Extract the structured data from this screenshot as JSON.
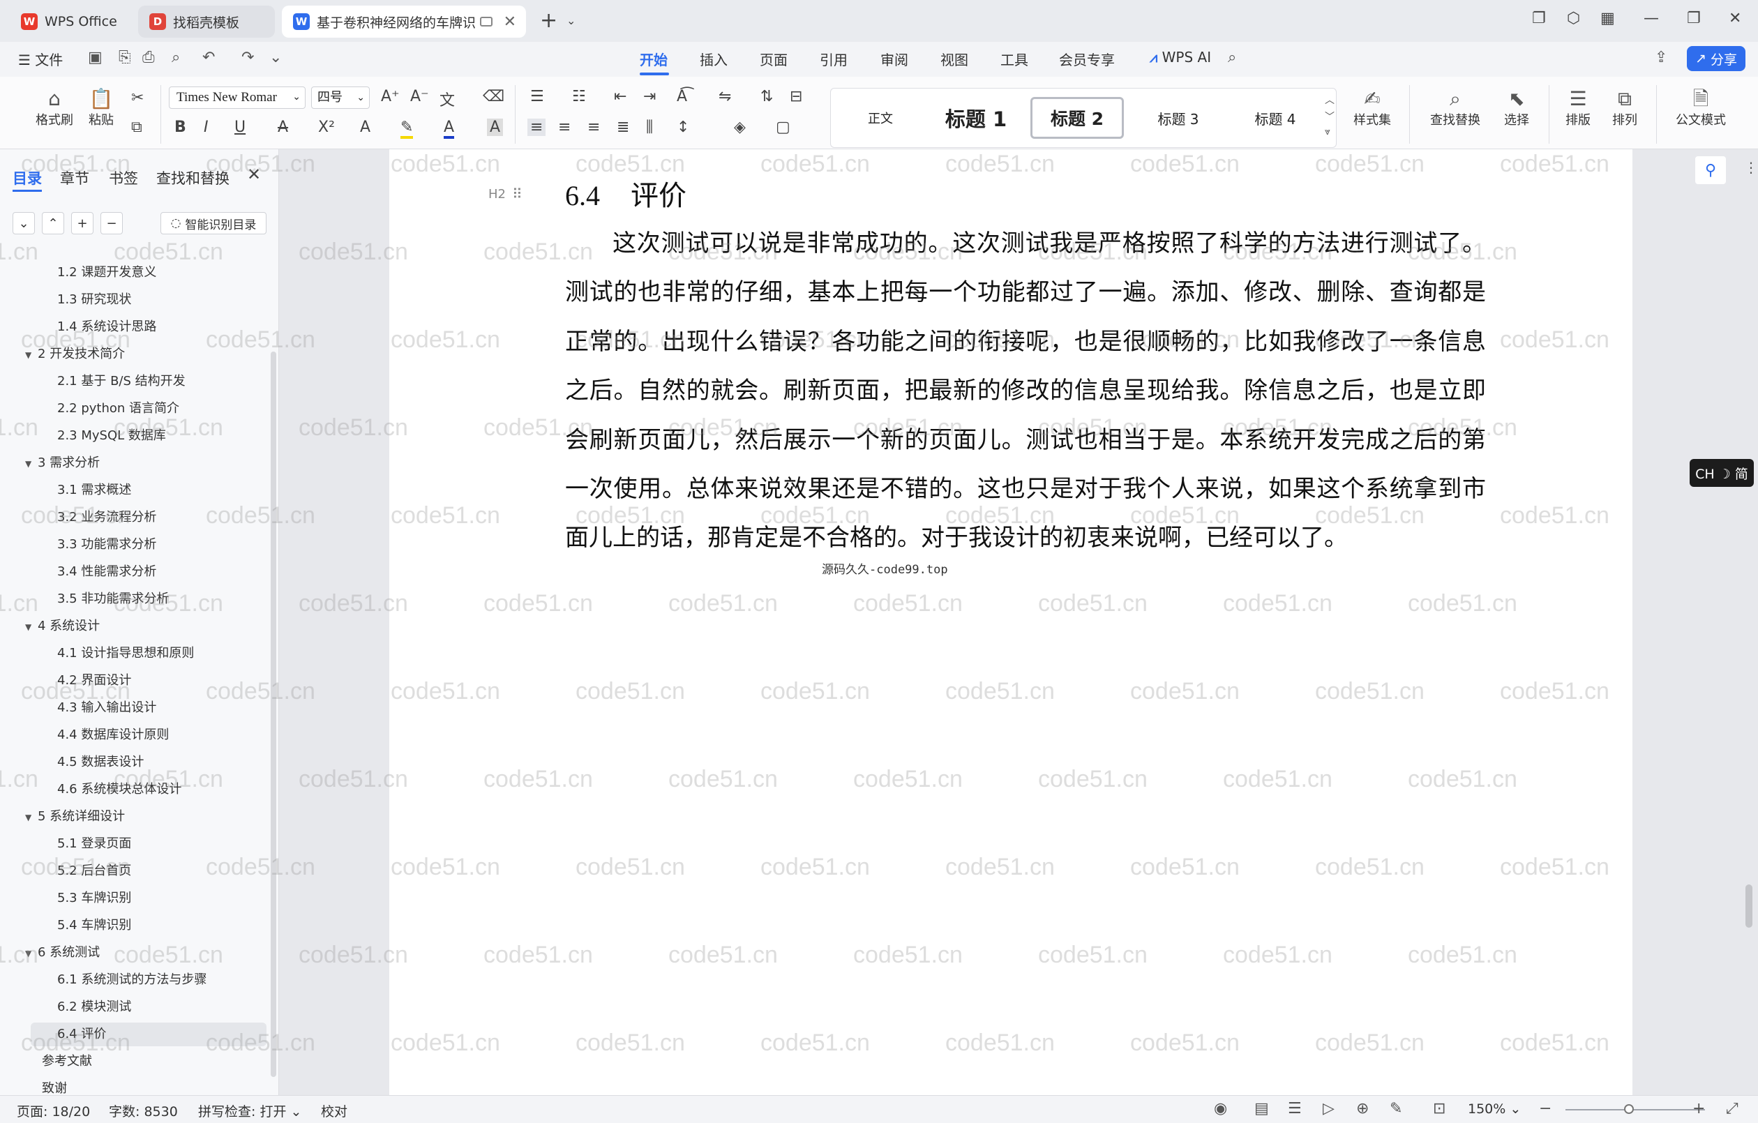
{
  "tabs": [
    {
      "label": "WPS Office"
    },
    {
      "label": "找稻壳模板"
    },
    {
      "label": "基于卷积神经网络的车牌识"
    }
  ],
  "menu": {
    "file": "文件",
    "items": [
      "开始",
      "插入",
      "页面",
      "引用",
      "审阅",
      "视图",
      "工具",
      "会员专享"
    ],
    "wps_ai": "WPS AI",
    "share": "分享"
  },
  "ribbon": {
    "format_painter": "格式刷",
    "paste": "粘贴",
    "font_name": "Times New Romar",
    "font_size": "四号",
    "styles": [
      "正文",
      "标题 1",
      "标题 2",
      "标题 3",
      "标题 4"
    ],
    "style_set": "样式集",
    "find_replace": "查找替换",
    "select": "选择",
    "layout": "排版",
    "arrange": "排列",
    "official_mode": "公文模式"
  },
  "panel": {
    "tabs": [
      "目录",
      "章节",
      "书签",
      "查找和替换"
    ],
    "smart_button": "智能识别目录",
    "toc": [
      {
        "text": "1.2   课题开发意义",
        "level": 2
      },
      {
        "text": "1.3   研究现状",
        "level": 2
      },
      {
        "text": "1.4   系统设计思路",
        "level": 2
      },
      {
        "text": "2   开发技术简介",
        "level": 1
      },
      {
        "text": "2.1   基于 B/S 结构开发",
        "level": 2
      },
      {
        "text": "2.2   python 语言简介",
        "level": 2
      },
      {
        "text": "2.3   MySQL 数据库",
        "level": 2
      },
      {
        "text": "3   需求分析",
        "level": 1
      },
      {
        "text": "3.1   需求概述",
        "level": 2
      },
      {
        "text": "3.2   业务流程分析",
        "level": 2
      },
      {
        "text": "3.3   功能需求分析",
        "level": 2
      },
      {
        "text": "3.4   性能需求分析",
        "level": 2
      },
      {
        "text": "3.5   非功能需求分析",
        "level": 2
      },
      {
        "text": "4   系统设计",
        "level": 1
      },
      {
        "text": "4.1   设计指导思想和原则",
        "level": 2
      },
      {
        "text": "4.2   界面设计",
        "level": 2
      },
      {
        "text": "4.3   输入输出设计",
        "level": 2
      },
      {
        "text": "4.4   数据库设计原则",
        "level": 2
      },
      {
        "text": "4.5 数据表设计",
        "level": 2
      },
      {
        "text": "4.6 系统模块总体设计",
        "level": 2
      },
      {
        "text": "5   系统详细设计",
        "level": 1
      },
      {
        "text": "5.1   登录页面",
        "level": 2
      },
      {
        "text": "5.2   后台首页",
        "level": 2
      },
      {
        "text": "5.3   车牌识别",
        "level": 2
      },
      {
        "text": "5.4   车牌识别",
        "level": 2
      },
      {
        "text": "6   系统测试",
        "level": 1
      },
      {
        "text": "6.1   系统测试的方法与步骤",
        "level": 2
      },
      {
        "text": "6.2   模块测试",
        "level": 2
      },
      {
        "text": "6.4   评价",
        "level": 2,
        "selected": true
      },
      {
        "text": "参考文献",
        "level": 0
      },
      {
        "text": "致谢",
        "level": 0
      }
    ]
  },
  "document": {
    "heading_mark": "H2",
    "heading_number": "6.4",
    "heading_text": "评价",
    "paragraph": "这次测试可以说是非常成功的。这次测试我是严格按照了科学的方法进行测试了。测试的也非常的仔细，基本上把每一个功能都过了一遍。添加、修改、删除、查询都是正常的。出现什么错误？各功能之间的衔接呢，也是很顺畅的，比如我修改了一条信息之后。自然的就会。刷新页面，把最新的修改的信息呈现给我。除信息之后，也是立即会刷新页面儿，然后展示一个新的页面儿。测试也相当于是。本系统开发完成之后的第一次使用。总体来说效果还是不错的。这也只是对于我个人来说，如果这个系统拿到市面儿上的话，那肯定是不合格的。对于我设计的初衷来说啊，已经可以了。",
    "caption": "源码久久-code99.top",
    "watermark": "code51.cn"
  },
  "ime": "CH ☽ 简",
  "status": {
    "page": "页面: 18/20",
    "words": "字数: 8530",
    "spell": "拼写检查: 打开",
    "proof": "校对",
    "zoom": "150%"
  },
  "colors": {
    "accent": "#2f6ded",
    "wps_red": "#e8392c",
    "docer_red": "#e0443a",
    "writer_blue": "#2f6ded"
  }
}
